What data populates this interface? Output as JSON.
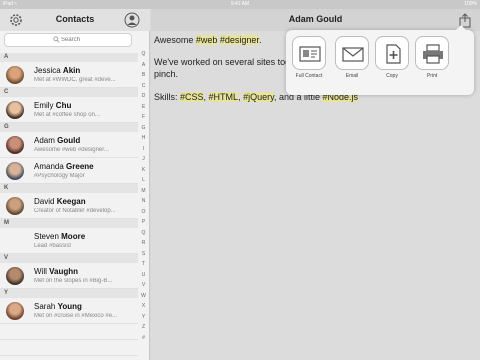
{
  "status_bar": {
    "left": "iPad ≈",
    "time": "9:41 AM",
    "right": "100%"
  },
  "sidebar": {
    "title": "Contacts",
    "search_placeholder": "Search",
    "sections": [
      {
        "letter": "A",
        "contacts": [
          {
            "first": "Jessica",
            "last": "Akin",
            "sub": "Met at #WWDC, great #deve..."
          }
        ]
      },
      {
        "letter": "C",
        "contacts": [
          {
            "first": "Emily",
            "last": "Chu",
            "sub": "Met at #coffee shop on..."
          }
        ]
      },
      {
        "letter": "G",
        "contacts": [
          {
            "first": "Adam",
            "last": "Gould",
            "sub": "Awesome #web #designer..."
          },
          {
            "first": "Amanda",
            "last": "Greene",
            "sub": "#Psychology Major"
          }
        ]
      },
      {
        "letter": "K",
        "contacts": [
          {
            "first": "David",
            "last": "Keegan",
            "sub": "Creator of Notable! #develop..."
          }
        ]
      },
      {
        "letter": "M",
        "contacts": [
          {
            "first": "Steven",
            "last": "Moore",
            "sub": "Lead #bassist"
          }
        ]
      },
      {
        "letter": "V",
        "contacts": [
          {
            "first": "Will",
            "last": "Vaughn",
            "sub": "Met on the slopes in #Big-B..."
          }
        ]
      },
      {
        "letter": "Y",
        "contacts": [
          {
            "first": "Sarah",
            "last": "Young",
            "sub": "Met on #cruise in #Mexico #e..."
          }
        ]
      }
    ],
    "index_letters": [
      "Q",
      "A",
      "B",
      "C",
      "D",
      "E",
      "F",
      "G",
      "H",
      "I",
      "J",
      "K",
      "L",
      "M",
      "N",
      "O",
      "P",
      "Q",
      "R",
      "S",
      "T",
      "U",
      "V",
      "W",
      "X",
      "Y",
      "Z",
      "#"
    ]
  },
  "main": {
    "title": "Adam Gould",
    "note": {
      "line1": {
        "pre": "Awesome ",
        "tags": [
          "#web",
          "#designer"
        ],
        "post": "."
      },
      "line2": "We've worked on several sites tog",
      "line3": "pinch.",
      "line4": {
        "pre": "Skills: ",
        "t1": "#CSS",
        "s1": ", ",
        "t2": "#HTML",
        "s2": ", ",
        "t3": "#jQuery",
        "s3": ", and a little ",
        "t4": "#Node.js"
      }
    }
  },
  "share": {
    "actions": [
      {
        "label": "Full Contact",
        "icon": "contact-card-icon"
      },
      {
        "label": "Email",
        "icon": "envelope-icon"
      },
      {
        "label": "Copy",
        "icon": "copy-icon"
      },
      {
        "label": "Print",
        "icon": "printer-icon"
      }
    ]
  },
  "colors": {
    "highlight": "#e8e39a",
    "sidebar_bg": "#f2f2f2",
    "content_bg": "#dcdcdc"
  }
}
